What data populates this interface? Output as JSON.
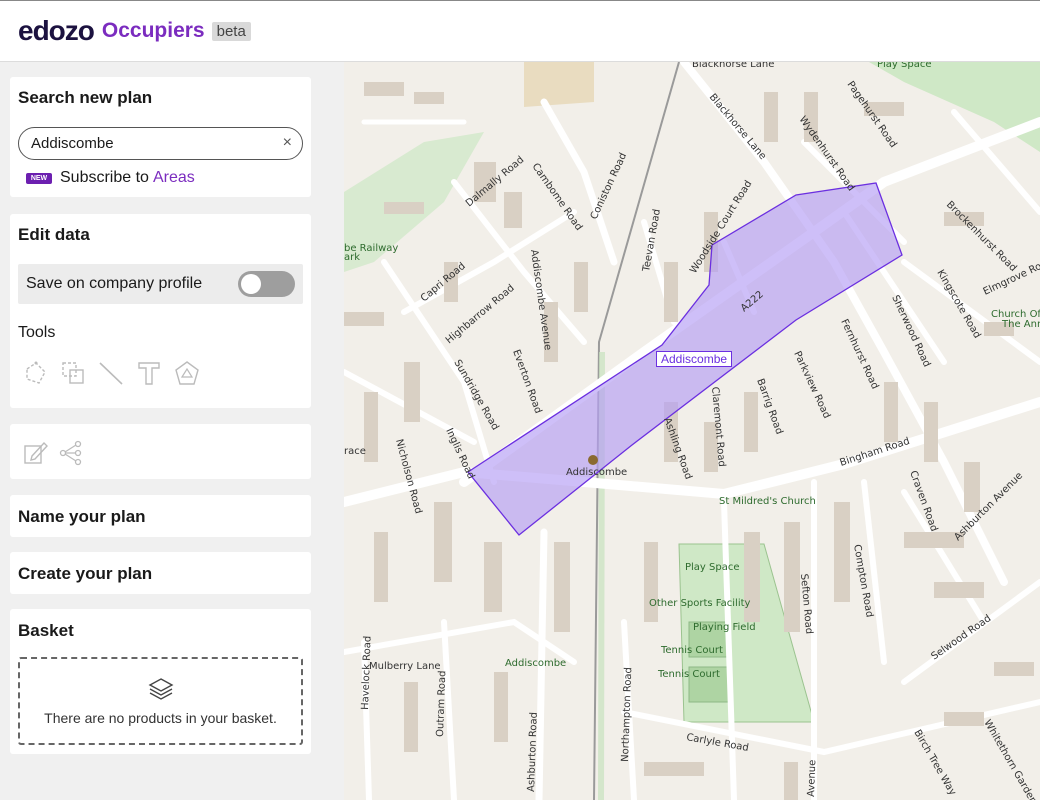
{
  "header": {
    "logo": "edozo",
    "product": "Occupiers",
    "badge": "beta"
  },
  "search": {
    "title": "Search new plan",
    "value": "Addiscombe",
    "clear_icon": "×",
    "subscribe_badge": "NEW",
    "subscribe_text": "Subscribe to",
    "subscribe_link": "Areas"
  },
  "edit": {
    "title": "Edit data",
    "save_label": "Save on company profile",
    "save_enabled": false,
    "tools_title": "Tools",
    "tools": [
      "draw-polygon-icon",
      "select-area-icon",
      "line-icon",
      "text-icon",
      "shape-icon"
    ]
  },
  "actions": [
    "edit-icon",
    "network-icon"
  ],
  "name_plan": {
    "title": "Name your plan"
  },
  "create_plan": {
    "title": "Create your plan"
  },
  "basket": {
    "title": "Basket",
    "empty_text": "There are no products in your basket.",
    "icon": "layers-icon"
  },
  "map": {
    "polygon_label": "Addiscombe",
    "highlight_color": "#b39df5",
    "place_labels": [
      "Addiscombe",
      "Addiscombe",
      "St Mildred's Church",
      "Play Space",
      "Other Sports Facility",
      "Playing Field",
      "Tennis Court",
      "Tennis Court",
      "Play Space",
      "Church Of The Ann",
      "be Railway ark",
      "A222",
      "race"
    ],
    "road_labels": [
      "Blackhorse Lane",
      "Blackhorse Lane",
      "Pagehurst Road",
      "Wydenhurst Road",
      "Dalmally Road",
      "Cambome Road",
      "Coniston Road",
      "Woodside Court Road",
      "Teevan Road",
      "Brockenhurst Road",
      "Kingscote Road",
      "Elmgrove Road",
      "Capri Road",
      "Addiscombe Avenue",
      "Highbarrow Road",
      "Sherwood Road",
      "Fernhurst Road",
      "Parkview Road",
      "Barrig Road",
      "Everton Road",
      "Sundridge Road",
      "Inglis Road",
      "Nicholson Road",
      "Claremont Road",
      "Ashling Road",
      "Bingham Road",
      "Craven Road",
      "Ashburton Avenue",
      "Compton Road",
      "Sefton Road",
      "Selwood Road",
      "Mulberry Lane",
      "Havelock Road",
      "Outram Road",
      "Northampton Road",
      "Ashburton Road",
      "Carlyle Road",
      "Birch Tree Way",
      "Whitethorn Gardens",
      "Avenue"
    ]
  }
}
